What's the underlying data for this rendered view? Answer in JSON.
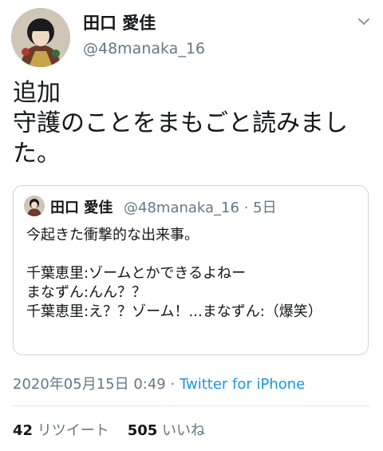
{
  "tweet": {
    "author_name": "田口 愛佳",
    "author_handle": "@48manaka_16",
    "text": "追加\n守護のことをまもごと読みました。",
    "icons": {
      "menu": "chevron-down-icon"
    }
  },
  "quoted_tweet": {
    "author_name": "田口 愛佳",
    "meta": "@48manaka_16 · 5日",
    "text": "今起きた衝撃的な出来事。\n\n千葉恵里:ゾームとかできるよねー\nまなずん:んん？？\n千葉恵里:え？？ゾーム！...まなずん:（爆笑）"
  },
  "footer": {
    "timestamp": "2020年05月15日 0:49",
    "separator": "·",
    "source": "Twitter for iPhone",
    "retweet_count": "42",
    "retweet_label": "リツイート",
    "like_count": "505",
    "like_label": "いいね"
  },
  "colors": {
    "text": "#14171a",
    "secondary": "#657786",
    "link": "#1b95e0",
    "border": "#ccd6dd"
  }
}
